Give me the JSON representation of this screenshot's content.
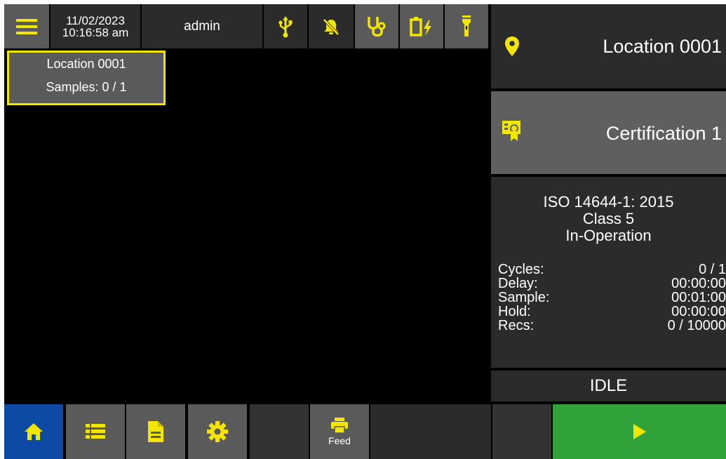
{
  "topbar": {
    "date": "11/02/2023",
    "time": "10:16:58 am",
    "user": "admin",
    "icons": [
      "menu-icon",
      "usb-icon",
      "bell-off-icon",
      "stethoscope-icon",
      "battery-charging-icon",
      "flashlight-icon"
    ]
  },
  "overlay": {
    "location": "Location 0001",
    "samples": "Samples: 0 / 1"
  },
  "panel": {
    "location": "Location 0001",
    "certification": "Certification 1",
    "standard": "ISO 14644-1: 2015",
    "class": "Class 5",
    "state": "In-Operation",
    "stats": [
      {
        "label": "Cycles:",
        "value": "0 / 1"
      },
      {
        "label": "Delay:",
        "value": "00:00:00"
      },
      {
        "label": "Sample:",
        "value": "00:01:00"
      },
      {
        "label": "Hold:",
        "value": "00:00:00"
      },
      {
        "label": "Recs:",
        "value": "0 / 10000"
      }
    ],
    "status": "IDLE"
  },
  "bottombar": {
    "feed_label": "Feed",
    "icons": [
      "home-icon",
      "list-icon",
      "document-icon",
      "gear-icon",
      "printer-icon",
      "play-icon"
    ]
  },
  "colors": {
    "accent_yellow": "#f2e600",
    "home_blue": "#0d4aa6",
    "start_green": "#31a13a",
    "tile_gray": "#5a5a5a",
    "tile_dark": "#2b2b2b"
  }
}
